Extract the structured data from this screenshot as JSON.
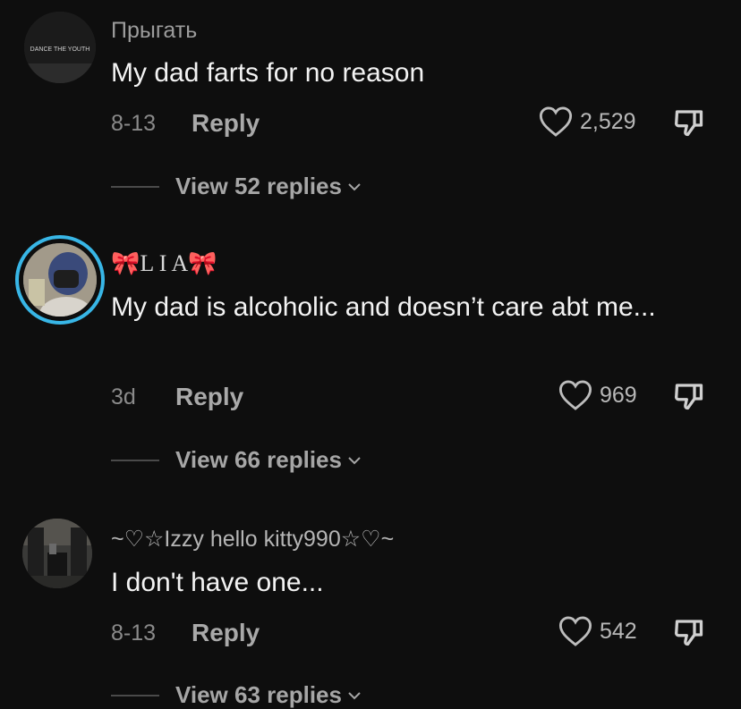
{
  "comments": [
    {
      "username": "Прыгать",
      "text": "My dad farts for no reason",
      "date": "8-13",
      "reply_label": "Reply",
      "likes": "2,529",
      "view_replies": "View 52 replies",
      "avatar_text": "DANCE THE YOUTH"
    },
    {
      "username_bow_left": "🎀",
      "username": "L I A",
      "username_bow_right": "🎀",
      "text": "My dad is alcoholic and doesn’t care abt me...",
      "date": "3d",
      "reply_label": "Reply",
      "likes": "969",
      "view_replies": "View 66 replies"
    },
    {
      "username": "~♡☆Izzy hello kitty990☆♡~",
      "text": "I don't have one...",
      "date": "8-13",
      "reply_label": "Reply",
      "likes": "542",
      "view_replies": "View 63 replies"
    }
  ],
  "colors": {
    "background": "#0e0e0e",
    "story_ring": "#38b6e6",
    "username": "#9c9c9c",
    "text": "#f3f3f3"
  }
}
